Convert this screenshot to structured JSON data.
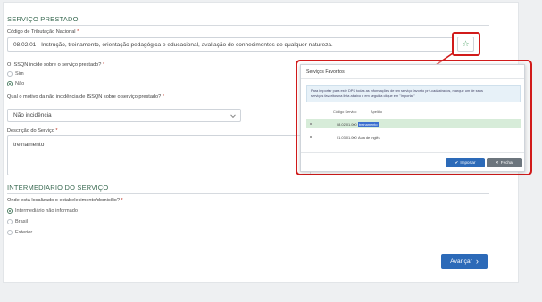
{
  "servico": {
    "section_title": "SERVIÇO PRESTADO",
    "codigo_label": "Código de Tributação Nacional",
    "codigo_value": "08.02.01 - Instrução, treinamento, orientação pedagógica e educacional, avaliação de conhecimentos de qualquer natureza.",
    "star_icon": "☆",
    "issqn_label": "O ISSQN incide sobre o serviço prestado?",
    "issqn_options": [
      "Sim",
      "Não"
    ],
    "issqn_selected": "Não",
    "motivo_label": "Qual o motivo da não incidência de ISSQN sobre o serviço prestado?",
    "motivo_value": "Não incidência",
    "descricao_label": "Descrição do Serviço",
    "descricao_value": "treinamento",
    "required_mark": "*"
  },
  "intermediario": {
    "section_title": "INTERMEDIARIO DO SERVIÇO",
    "local_label": "Onde está localizado o estabelecimento/domicílio?",
    "options": [
      "Intermediário não informado",
      "Brasil",
      "Exterior"
    ],
    "selected": "Intermediário não informado"
  },
  "footer": {
    "next_label": "Avançar",
    "next_icon": "›"
  },
  "modal": {
    "title": "Serviços Favoritos",
    "info_line1": "Para importar para este DPS todas as informações de um serviço favorito pré-cadastrados, marque um de seus",
    "info_line2": "serviços favoritos na lista abaixo e em seguida clique em \"Importar\"",
    "col_codigo": "Código Serviço",
    "col_apelido": "Apelido",
    "rows": [
      {
        "codigo": "08.02.01.000",
        "apelido": "treinamento"
      },
      {
        "codigo": "01.03.01.000",
        "apelido": "Aula de Inglês"
      }
    ],
    "import_label": "Importar",
    "close_label": "Fechar",
    "check_icon": "✔",
    "x_icon": "✕"
  },
  "colors": {
    "accent_green": "#3a6a52",
    "highlight_red": "#d11b1b",
    "primary_blue": "#2c6ab8",
    "selected_row": "#d7ecd9"
  }
}
